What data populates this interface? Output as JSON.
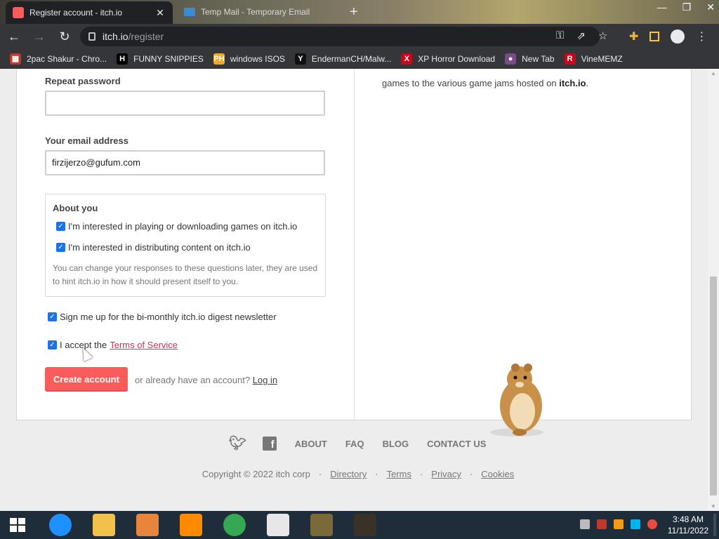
{
  "browser": {
    "active_tab_title": "Register account - itch.io",
    "inactive_tab_title": "Temp Mail - Temporary Email",
    "url_host": "itch.io",
    "url_path": "/register",
    "bookmarks": [
      {
        "label": "2pac Shakur - Chro...",
        "color": "#c0392b",
        "glyph": "▦"
      },
      {
        "label": "FUNNY SNIPPIES",
        "color": "#000000",
        "glyph": "H"
      },
      {
        "label": "windows ISOS",
        "color": "#f5a623",
        "glyph": "PH"
      },
      {
        "label": "EndermanCH/Malw...",
        "color": "#111111",
        "glyph": "Y"
      },
      {
        "label": "XP Horror Download",
        "color": "#d0021b",
        "glyph": "X"
      },
      {
        "label": "New Tab",
        "color": "#7a4a8a",
        "glyph": "●"
      },
      {
        "label": "VineMEMZ",
        "color": "#d0021b",
        "glyph": "R"
      }
    ]
  },
  "form": {
    "repeat_password_label": "Repeat password",
    "email_label": "Your email address",
    "email_value": "firzijerzo@gufum.com",
    "about_title": "About you",
    "interest_play": "I'm interested in playing or downloading games on itch.io",
    "interest_distribute": "I'm interested in distributing content on itch.io",
    "hint": "You can change your responses to these questions later, they are used to hint itch.io in how it should present itself to you.",
    "newsletter": "Sign me up for the bi-monthly itch.io digest newsletter",
    "accept_prefix": "I accept the",
    "tos_link": "Terms of Service",
    "create_button": "Create account",
    "alt_prefix": "or already have an account?",
    "login_link": "Log in"
  },
  "side": {
    "text": "games to the various game jams hosted on",
    "bold": "itch.io",
    "suffix": "."
  },
  "footer": {
    "links": [
      "ABOUT",
      "FAQ",
      "BLOG",
      "CONTACT US"
    ],
    "copyright": "Copyright © 2022 itch corp",
    "sep": "·",
    "legal": [
      "Directory",
      "Terms",
      "Privacy",
      "Cookies"
    ]
  },
  "taskbar": {
    "time": "3:48 AM",
    "date": "11/11/2022"
  },
  "colors": {
    "accent": "#fa5c5c",
    "link": "#da2c55",
    "checkbox": "#1a73e8"
  }
}
